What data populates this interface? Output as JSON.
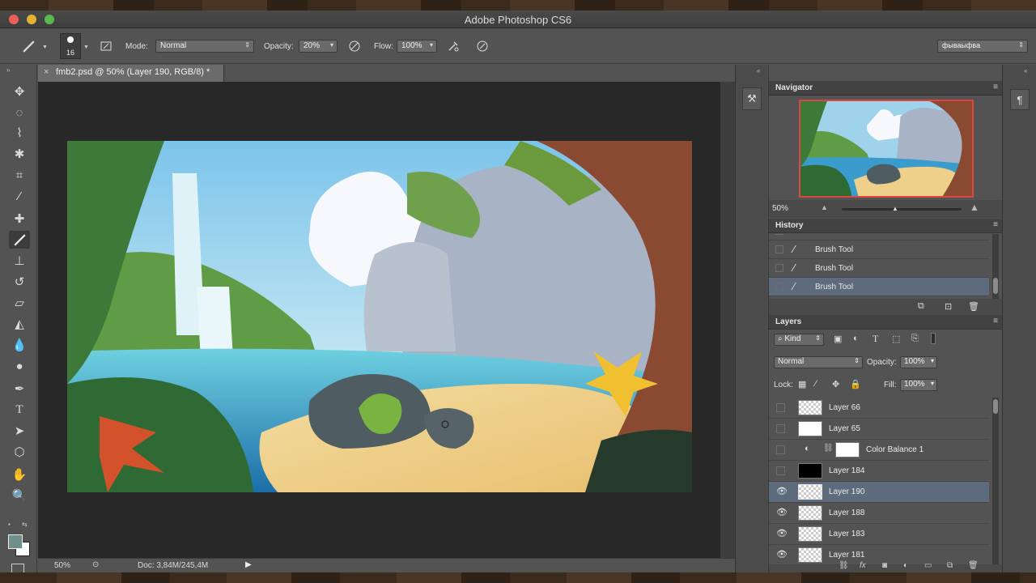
{
  "window": {
    "title": "Adobe Photoshop CS6"
  },
  "options_bar": {
    "brush_size": "16",
    "mode_label": "Mode:",
    "mode_value": "Normal",
    "opacity_label": "Opacity:",
    "opacity_value": "20%",
    "flow_label": "Flow:",
    "flow_value": "100%",
    "workspace": "фываыфва"
  },
  "document": {
    "tab_title": "fmb2.psd @ 50% (Layer 190, RGB/8) *",
    "zoom": "50%",
    "doc_size": "Doc: 3,84M/245,4M"
  },
  "navigator": {
    "title": "Navigator",
    "zoom": "50%"
  },
  "history": {
    "title": "History",
    "items": [
      {
        "label": "Brush Tool",
        "selected": false
      },
      {
        "label": "Brush Tool",
        "selected": false
      },
      {
        "label": "Brush Tool",
        "selected": true
      }
    ]
  },
  "layers": {
    "title": "Layers",
    "filter_kind": "Kind",
    "blend_mode": "Normal",
    "opacity_label": "Opacity:",
    "opacity_value": "100%",
    "lock_label": "Lock:",
    "fill_label": "Fill:",
    "fill_value": "100%",
    "items": [
      {
        "name": "Layer 66",
        "visible": false,
        "thumb": "checker",
        "selected": false
      },
      {
        "name": "Layer 65",
        "visible": false,
        "thumb": "white",
        "selected": false
      },
      {
        "name": "Color Balance 1",
        "visible": false,
        "thumb": "adjustment",
        "selected": false
      },
      {
        "name": "Layer 184",
        "visible": false,
        "thumb": "black",
        "selected": false
      },
      {
        "name": "Layer 190",
        "visible": true,
        "thumb": "checker",
        "selected": true
      },
      {
        "name": "Layer 188",
        "visible": true,
        "thumb": "checker",
        "selected": false
      },
      {
        "name": "Layer 183",
        "visible": true,
        "thumb": "checker",
        "selected": false
      },
      {
        "name": "Layer 181",
        "visible": true,
        "thumb": "checker",
        "selected": false
      }
    ]
  },
  "colors": {
    "selection": "#5d6b7c",
    "foreground": "#6f8f8a",
    "background": "#ffffff"
  }
}
